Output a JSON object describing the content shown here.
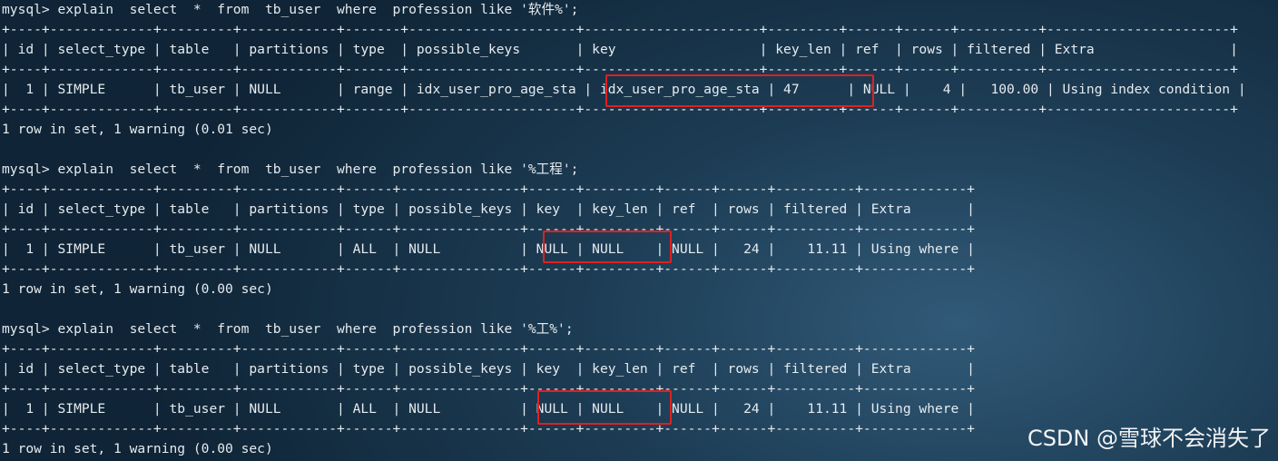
{
  "terminal": {
    "blocks": [
      {
        "command": "mysql> explain  select  *  from  tb_user  where  profession like '软件%';",
        "border": "+----+-------------+---------+------------+-------+---------------------+----------------------+---------+------+------+----------+-----------------------+",
        "header": "| id | select_type | table   | partitions | type  | possible_keys       | key                  | key_len | ref  | rows | filtered | Extra                 |",
        "row": "|  1 | SIMPLE      | tb_user | NULL       | range | idx_user_pro_age_sta | idx_user_pro_age_sta | 47      | NULL |    4 |   100.00 | Using index condition |",
        "result": "1 row in set, 1 warning (0.01 sec)"
      },
      {
        "command": "mysql> explain  select  *  from  tb_user  where  profession like '%工程';",
        "border": "+----+-------------+---------+------------+------+---------------+------+---------+------+------+----------+-------------+",
        "header": "| id | select_type | table   | partitions | type | possible_keys | key  | key_len | ref  | rows | filtered | Extra       |",
        "row": "|  1 | SIMPLE      | tb_user | NULL       | ALL  | NULL          | NULL | NULL    | NULL |   24 |    11.11 | Using where |",
        "result": "1 row in set, 1 warning (0.00 sec)"
      },
      {
        "command": "mysql> explain  select  *  from  tb_user  where  profession like '%工%';",
        "border": "+----+-------------+---------+------------+------+---------------+------+---------+------+------+----------+-------------+",
        "header": "| id | select_type | table   | partitions | type | possible_keys | key  | key_len | ref  | rows | filtered | Extra       |",
        "row": "|  1 | SIMPLE      | tb_user | NULL       | ALL  | NULL          | NULL | NULL    | NULL |   24 |    11.11 | Using where |",
        "result": "1 row in set, 1 warning (0.00 sec)"
      }
    ]
  },
  "watermark": "CSDN @雪球不会消失了",
  "colors": {
    "highlight": "#e02020",
    "text": "#e6ebef"
  }
}
